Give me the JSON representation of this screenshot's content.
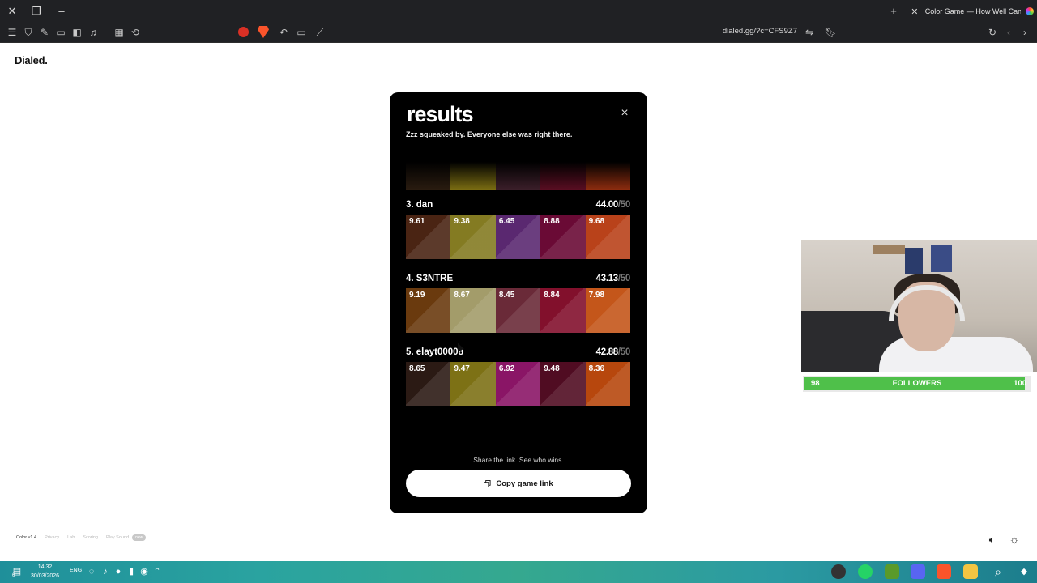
{
  "browser": {
    "tab_title": "Color Game — How Well Can You See Color?",
    "url": "dialed.gg/?c=CFS9Z7"
  },
  "page": {
    "brand": "Dialed.",
    "footer": {
      "version": "Color v1.4",
      "links": [
        "Privacy",
        "Lab",
        "Scoring",
        "Play Sound"
      ],
      "badge": "new"
    }
  },
  "modal": {
    "title": "results",
    "subtitle": "Zzz squeaked by. Everyone else was right there.",
    "partial_row_colors": [
      "#2a1c10",
      "#7c6e12",
      "#3c1f2a",
      "#5a0e22",
      "#8e2d0f"
    ],
    "entries": [
      {
        "name": "3. dan",
        "score": "44.00",
        "max": "/50",
        "cells": [
          {
            "value": "9.61",
            "color": "#4a2413"
          },
          {
            "value": "9.38",
            "color": "#847b22"
          },
          {
            "value": "6.45",
            "color": "#5a2870"
          },
          {
            "value": "8.88",
            "color": "#6a0a35"
          },
          {
            "value": "9.68",
            "color": "#b9421a"
          }
        ]
      },
      {
        "name": "4. S3NTRE",
        "score": "43.13",
        "max": "/50",
        "cells": [
          {
            "value": "9.19",
            "color": "#6a3a0e"
          },
          {
            "value": "8.67",
            "color": "#a39c6a"
          },
          {
            "value": "8.45",
            "color": "#6a2a38"
          },
          {
            "value": "8.84",
            "color": "#82102c"
          },
          {
            "value": "7.98",
            "color": "#c4561a"
          }
        ]
      },
      {
        "name": "5. elayt00008",
        "score": "42.88",
        "max": "/50",
        "cells": [
          {
            "value": "8.65",
            "color": "#2b1a14"
          },
          {
            "value": "9.47",
            "color": "#7d7115"
          },
          {
            "value": "6.92",
            "color": "#8a1566"
          },
          {
            "value": "9.48",
            "color": "#500c22"
          },
          {
            "value": "8.36",
            "color": "#b7470d"
          }
        ]
      }
    ],
    "share_text": "Share the link. See who wins.",
    "copy_label": "Copy game link"
  },
  "stream": {
    "followers_current": "98",
    "followers_label": "FOLLOWERS",
    "followers_goal": "100",
    "followers_progress": 0.98
  },
  "taskbar": {
    "time": "14:32",
    "date": "30/03/2026",
    "lang": "ENG",
    "notif_count": "6"
  }
}
